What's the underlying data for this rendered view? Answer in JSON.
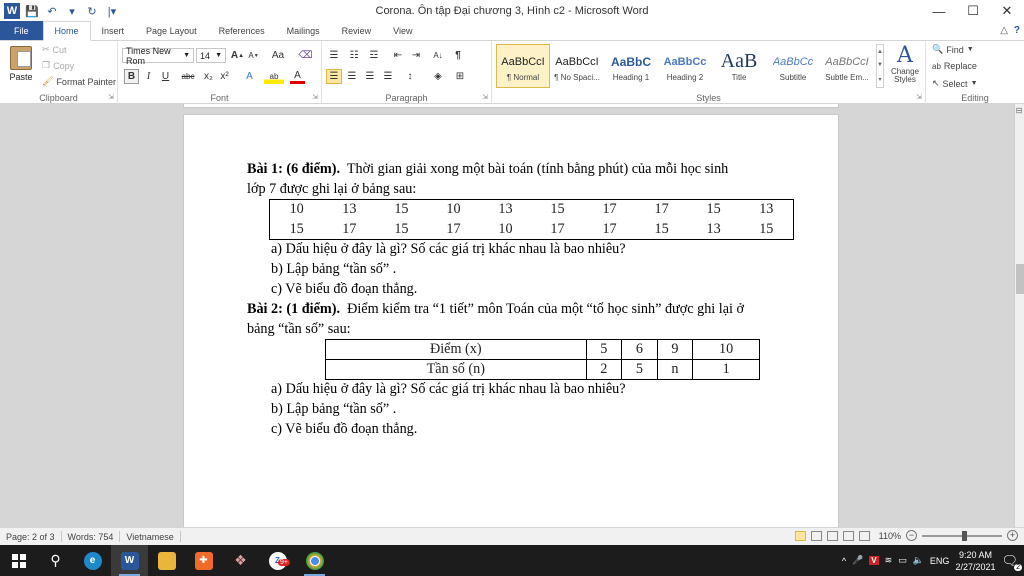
{
  "window": {
    "title": "Corona. Ôn tập Đại chương 3, Hình c2  -  Microsoft Word",
    "qat": {
      "save_icon": "💾",
      "undo_icon": "↶",
      "redo_icon": "↻",
      "more_icon": "▾",
      "customize_icon": "|▾"
    },
    "controls": {
      "minimize": "—",
      "maximize": "☐",
      "close": "✕"
    }
  },
  "ribbon_tabs": [
    "File",
    "Home",
    "Insert",
    "Page Layout",
    "References",
    "Mailings",
    "Review",
    "View"
  ],
  "ribbon_right": {
    "minimize_icon": "△",
    "help_icon": "?"
  },
  "clipboard": {
    "paste": "Paste",
    "cut": "Cut",
    "copy": "Copy",
    "format_painter": "Format Painter",
    "label": "Clipboard"
  },
  "font": {
    "name": "Times New Rom",
    "size": "14",
    "label": "Font",
    "grow": "A",
    "shrink": "A",
    "change_case": "Aa",
    "clear": "⌫",
    "bold": "B",
    "italic": "I",
    "underline": "U",
    "strike": "abc",
    "subscript": "x₂",
    "superscript": "x²",
    "text_effects": "A",
    "highlight": "ab",
    "font_color": "A"
  },
  "paragraph": {
    "label": "Paragraph",
    "sort": "A↓",
    "pilcrow": "¶"
  },
  "styles": {
    "label": "Styles",
    "items": [
      {
        "preview": "AaBbCcI",
        "name": "¶ Normal"
      },
      {
        "preview": "AaBbCcI",
        "name": "¶ No Spaci..."
      },
      {
        "preview": "AaBbC",
        "name": "Heading 1"
      },
      {
        "preview": "AaBbCc",
        "name": "Heading 2"
      },
      {
        "preview": "AaB",
        "name": "Title"
      },
      {
        "preview": "AaBbCc",
        "name": "Subtitle"
      },
      {
        "preview": "AaBbCcI",
        "name": "Subtle Em..."
      }
    ],
    "change_styles": "Change Styles",
    "change_styles_icon": "A"
  },
  "editing": {
    "label": "Editing",
    "find": "Find",
    "replace": "Replace",
    "select": "Select"
  },
  "document": {
    "bai1_title": "Bài 1: (6 điểm).",
    "bai1_text1": "Thời gian giải xong một bài toán (tính bằng phút) của mỗi học sinh",
    "bai1_text2": "lớp 7 được ghi lại ở bảng sau:",
    "table1": [
      [
        "10",
        "13",
        "15",
        "10",
        "13",
        "15",
        "17",
        "17",
        "15",
        "13"
      ],
      [
        "15",
        "17",
        "15",
        "17",
        "10",
        "17",
        "17",
        "15",
        "13",
        "15"
      ]
    ],
    "q1a": "a) Dấu hiệu ở đây là gì? Số các giá trị khác nhau là bao nhiêu?",
    "q1b": "b) Lập bảng “tần số” .",
    "q1c": "c) Vẽ biểu đồ đoạn thẳng.",
    "bai2_title": "Bài 2: (1 điểm).",
    "bai2_text1": "Điểm kiểm tra “1 tiết” môn Toán của một “tổ học sinh” được ghi lại ở",
    "bai2_text2": "bảng “tần số” sau:",
    "table2": [
      [
        "Điểm (x)",
        "5",
        "6",
        "9",
        "10"
      ],
      [
        "Tần số (n)",
        "2",
        "5",
        "n",
        "1"
      ]
    ],
    "q2a": "a) Dấu hiệu ở đây là gì? Số các giá trị khác nhau là bao nhiêu?",
    "q2b": "b) Lập bảng “tần số” .",
    "q2c": "c) Vẽ biểu đồ đoạn thẳng."
  },
  "statusbar": {
    "page": "Page: 2 of 3",
    "words": "Words: 754",
    "language": "Vietnamese",
    "zoom": "110%"
  },
  "taskbar": {
    "clock_time": "9:20 AM",
    "clock_date": "2/27/2021",
    "language": "ENG",
    "notification_count": "2",
    "badge": "9+"
  }
}
